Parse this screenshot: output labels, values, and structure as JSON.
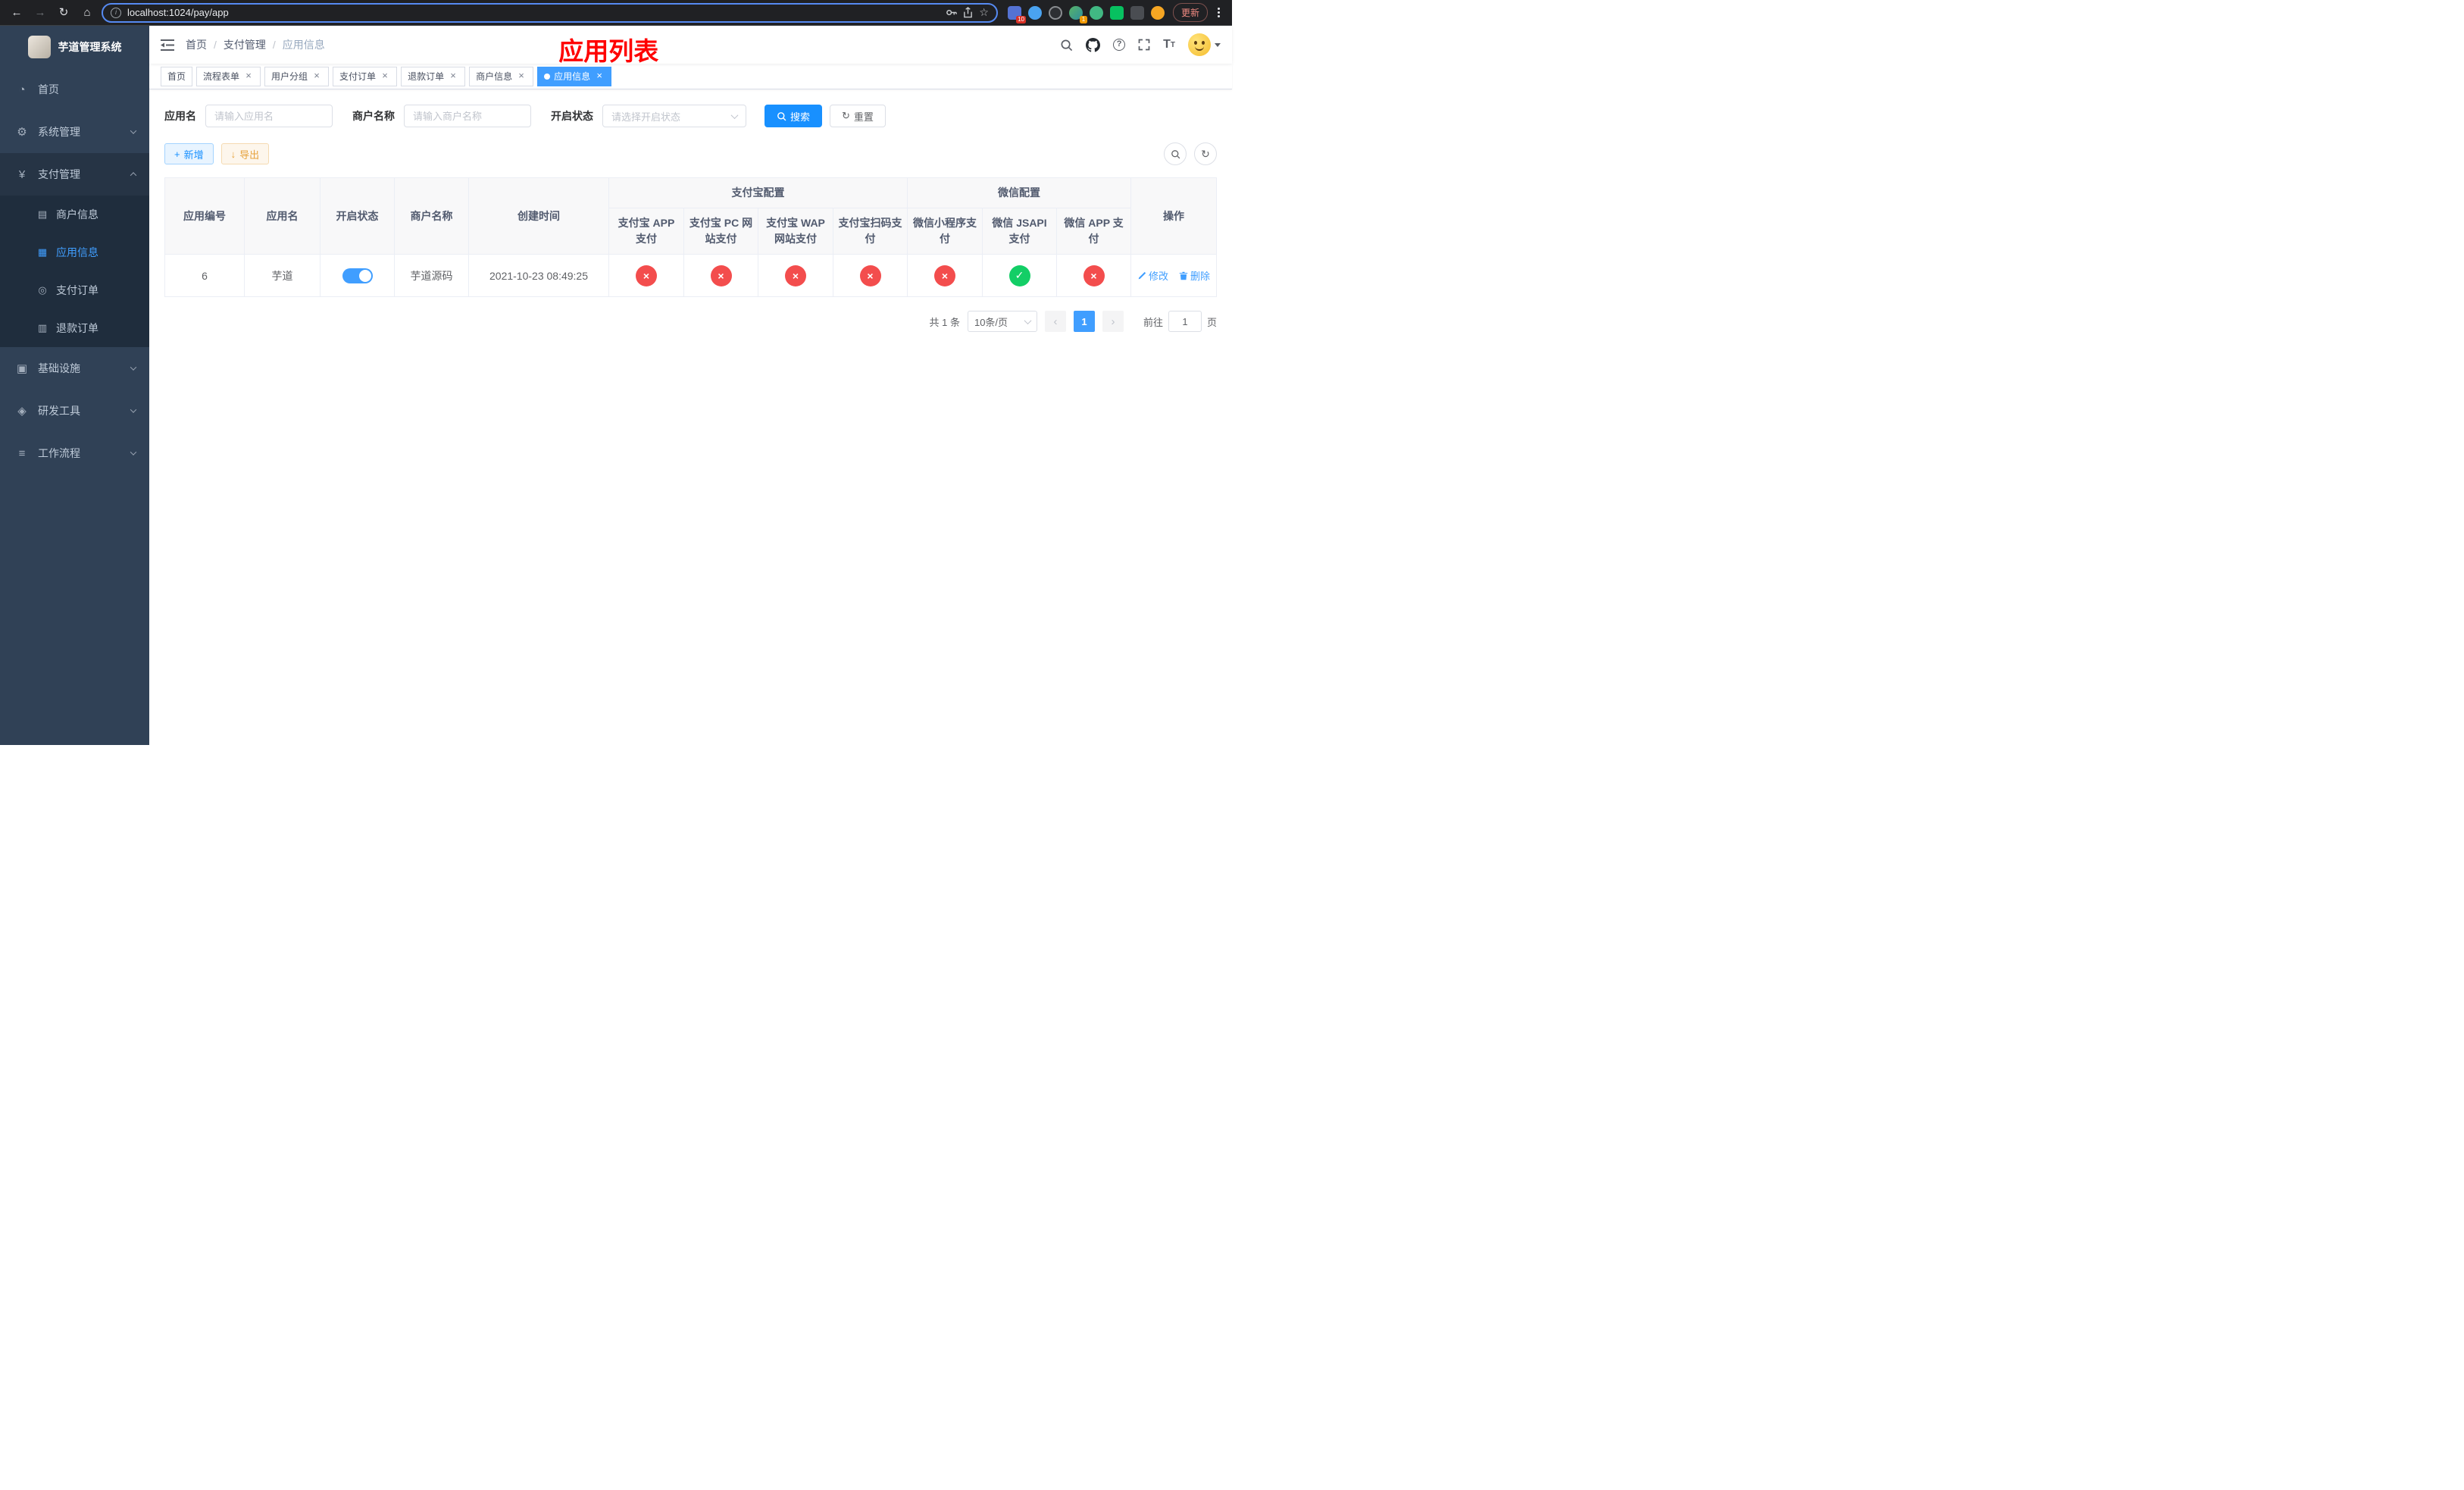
{
  "browser": {
    "url": "localhost:1024/pay/app",
    "update_label": "更新",
    "ext_badge_10": "10",
    "ext_badge_1": "1"
  },
  "sidebar": {
    "title": "芋道管理系统",
    "home": "首页",
    "system": "系统管理",
    "payment": "支付管理",
    "merchant_info": "商户信息",
    "app_info": "应用信息",
    "pay_order": "支付订单",
    "refund_order": "退款订单",
    "infrastructure": "基础设施",
    "dev_tools": "研发工具",
    "workflow": "工作流程"
  },
  "breadcrumb": {
    "home": "首页",
    "payment": "支付管理",
    "current": "应用信息"
  },
  "annotation": "应用列表",
  "tabs": [
    {
      "label": "首页"
    },
    {
      "label": "流程表单"
    },
    {
      "label": "用户分组"
    },
    {
      "label": "支付订单"
    },
    {
      "label": "退款订单"
    },
    {
      "label": "商户信息"
    },
    {
      "label": "应用信息"
    }
  ],
  "filters": {
    "app_name_label": "应用名",
    "app_name_placeholder": "请输入应用名",
    "merchant_label": "商户名称",
    "merchant_placeholder": "请输入商户名称",
    "status_label": "开启状态",
    "status_placeholder": "请选择开启状态",
    "search": "搜索",
    "reset": "重置"
  },
  "toolbar": {
    "add": "新增",
    "export": "导出"
  },
  "table": {
    "headers": {
      "app_id": "应用编号",
      "app_name": "应用名",
      "status": "开启状态",
      "merchant": "商户名称",
      "created": "创建时间",
      "alipay_group": "支付宝配置",
      "wechat_group": "微信配置",
      "alipay_app": "支付宝 APP 支付",
      "alipay_pc": "支付宝 PC 网站支付",
      "alipay_wap": "支付宝 WAP 网站支付",
      "alipay_qr": "支付宝扫码支付",
      "wx_mini": "微信小程序支付",
      "wx_jsapi": "微信 JSAPI 支付",
      "wx_app": "微信 APP 支付",
      "actions": "操作"
    },
    "row": {
      "app_id": "6",
      "app_name": "芋道",
      "enabled": true,
      "merchant": "芋道源码",
      "created": "2021-10-23 08:49:25",
      "alipay_app": false,
      "alipay_pc": false,
      "alipay_wap": false,
      "alipay_qr": false,
      "wx_mini": false,
      "wx_jsapi": true,
      "wx_app": false,
      "edit": "修改",
      "delete": "删除"
    }
  },
  "pagination": {
    "total": "共 1 条",
    "page_size": "10条/页",
    "page": "1",
    "goto": "前往",
    "goto_value": "1",
    "unit": "页"
  },
  "icons": {
    "back": "←",
    "forward": "→",
    "reload": "↻",
    "home": "⌂",
    "star": "☆",
    "dashboard": "◔",
    "gear": "⚙",
    "yen": "¥",
    "merchant": "▤",
    "grid": "▦",
    "order": "◎",
    "refund": "▥",
    "infra": "▣",
    "tools": "◈",
    "workflow": "≡",
    "close": "×",
    "reset": "↻",
    "add": "+",
    "export": "↓",
    "refresh": "↻",
    "fail": "×",
    "success": "✓",
    "prev": "‹",
    "next": "›",
    "help": "?"
  },
  "colors": {
    "primary": "#409eff",
    "search_blue": "#1890ff",
    "success": "#13ce66",
    "danger": "#f34d4d",
    "warning": "#e6a23c",
    "annotation_red": "#ff0000",
    "sidebar_bg": "#304156",
    "submenu_bg": "#1f2d3d"
  }
}
